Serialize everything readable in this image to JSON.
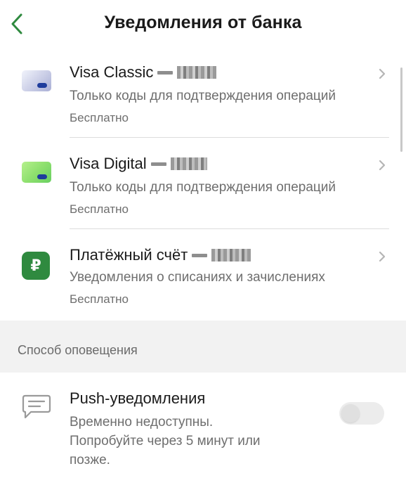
{
  "header": {
    "title": "Уведомления от банка",
    "back_icon": "chevron-left-icon",
    "accent_color": "#2f8a3f"
  },
  "products": [
    {
      "title": "Visa Classic",
      "subtitle": "Только коды для подтверждения операций",
      "price": "Бесплатно",
      "icon": "card-icon"
    },
    {
      "title": "Visa Digital",
      "subtitle": "Только коды для подтверждения операций",
      "price": "Бесплатно",
      "icon": "card-icon"
    },
    {
      "title": "Платёжный счёт",
      "subtitle": "Уведомления о списаниях и зачислениях",
      "price": "Бесплатно",
      "icon": "ruble-icon",
      "icon_text": "₽"
    }
  ],
  "notification_section": {
    "title": "Способ оповещения",
    "push": {
      "title": "Push-уведомления",
      "line1": "Временно недоступны.",
      "line2": "Попробуйте через 5 минут или",
      "line3": "позже.",
      "icon": "message-icon",
      "enabled": false
    }
  }
}
